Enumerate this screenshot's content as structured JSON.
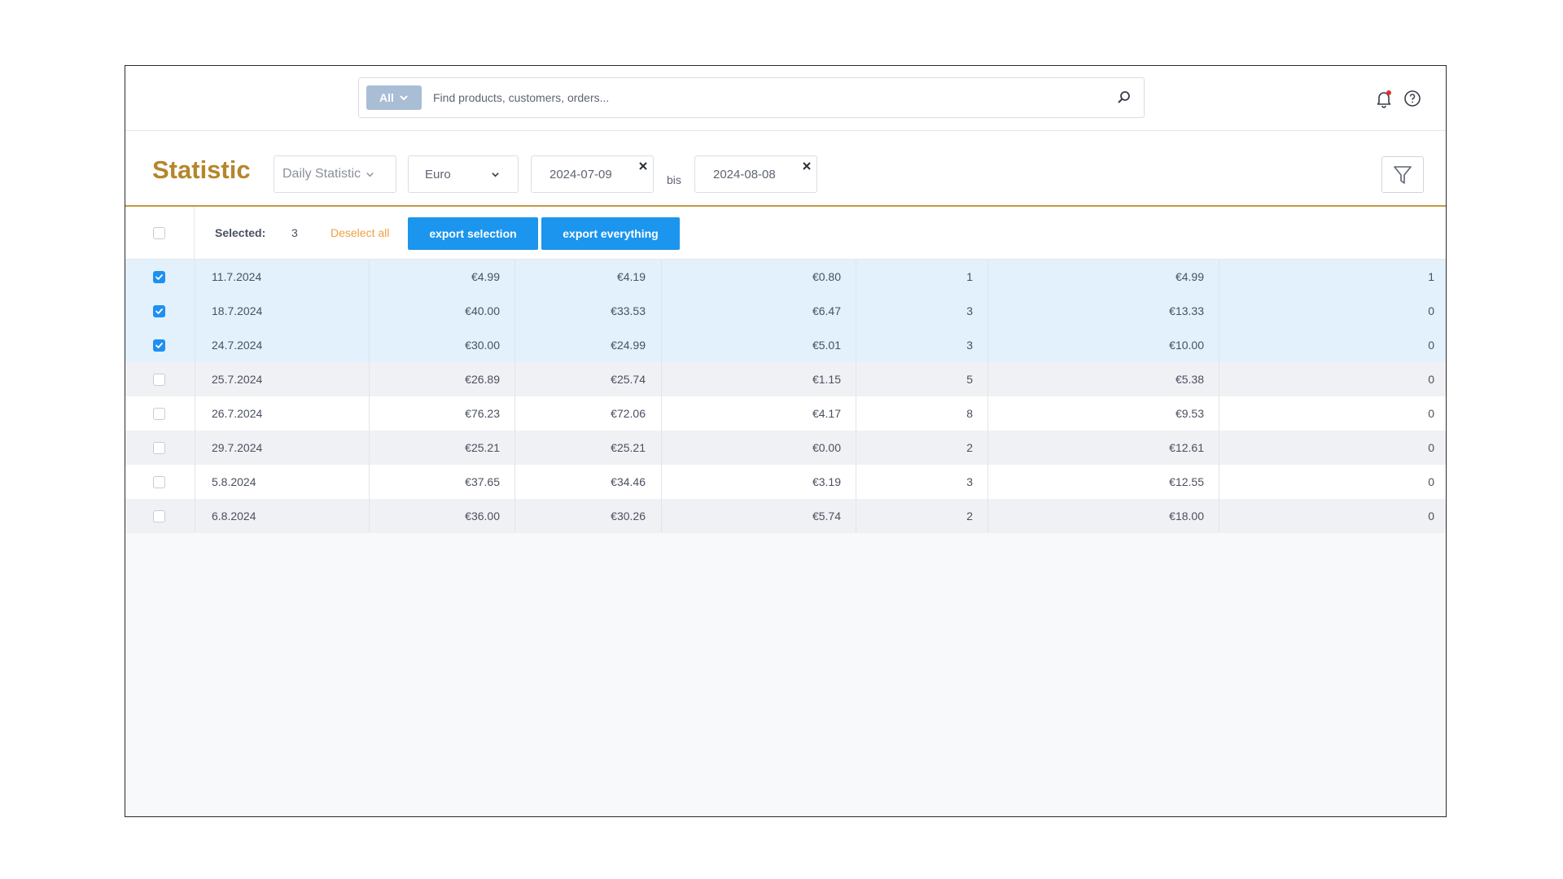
{
  "search": {
    "scope_label": "All",
    "placeholder": "Find products, customers, orders...",
    "value": ""
  },
  "header": {
    "title": "Statistic",
    "statistic_type": "Daily Statistic",
    "currency": "Euro",
    "date_from": "2024-07-09",
    "range_separator": "bis",
    "date_to": "2024-08-08"
  },
  "selection": {
    "label": "Selected:",
    "count": "3",
    "deselect_label": "Deselect all",
    "export_selection_label": "export selection",
    "export_everything_label": "export everything"
  },
  "colors": {
    "accent": "#b5862b",
    "primary_button": "#1b95ee",
    "deselect": "#f0a040",
    "selected_row": "#e2f1fc"
  },
  "rows": [
    {
      "selected": true,
      "date": "11.7.2024",
      "c1": "€4.99",
      "c2": "€4.19",
      "c3": "€0.80",
      "c4": "1",
      "c5": "€4.99",
      "c6": "1"
    },
    {
      "selected": true,
      "date": "18.7.2024",
      "c1": "€40.00",
      "c2": "€33.53",
      "c3": "€6.47",
      "c4": "3",
      "c5": "€13.33",
      "c6": "0"
    },
    {
      "selected": true,
      "date": "24.7.2024",
      "c1": "€30.00",
      "c2": "€24.99",
      "c3": "€5.01",
      "c4": "3",
      "c5": "€10.00",
      "c6": "0"
    },
    {
      "selected": false,
      "date": "25.7.2024",
      "c1": "€26.89",
      "c2": "€25.74",
      "c3": "€1.15",
      "c4": "5",
      "c5": "€5.38",
      "c6": "0"
    },
    {
      "selected": false,
      "date": "26.7.2024",
      "c1": "€76.23",
      "c2": "€72.06",
      "c3": "€4.17",
      "c4": "8",
      "c5": "€9.53",
      "c6": "0"
    },
    {
      "selected": false,
      "date": "29.7.2024",
      "c1": "€25.21",
      "c2": "€25.21",
      "c3": "€0.00",
      "c4": "2",
      "c5": "€12.61",
      "c6": "0"
    },
    {
      "selected": false,
      "date": "5.8.2024",
      "c1": "€37.65",
      "c2": "€34.46",
      "c3": "€3.19",
      "c4": "3",
      "c5": "€12.55",
      "c6": "0"
    },
    {
      "selected": false,
      "date": "6.8.2024",
      "c1": "€36.00",
      "c2": "€30.26",
      "c3": "€5.74",
      "c4": "2",
      "c5": "€18.00",
      "c6": "0"
    }
  ]
}
